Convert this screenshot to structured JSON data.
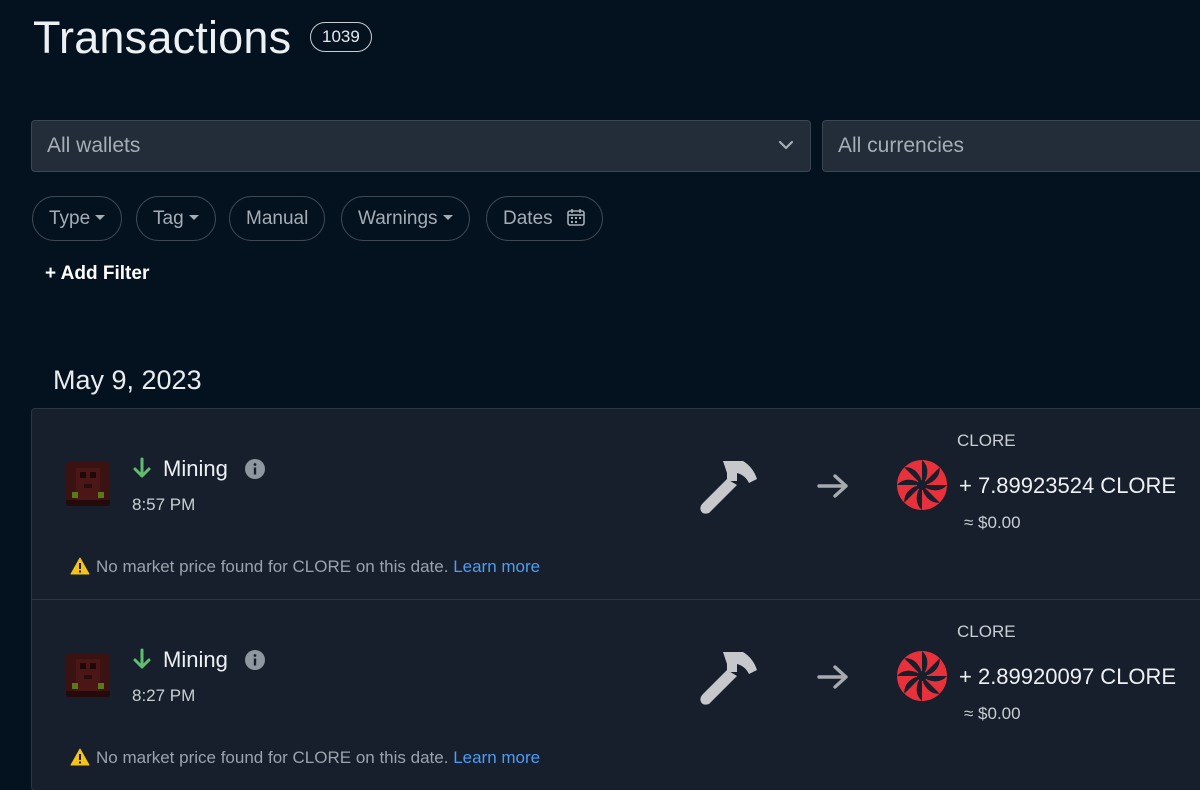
{
  "header": {
    "title": "Transactions",
    "count": "1039"
  },
  "filters": {
    "wallets_select": "All wallets",
    "currencies_select": "All currencies",
    "pills": {
      "type": "Type",
      "tag": "Tag",
      "manual": "Manual",
      "warnings": "Warnings",
      "dates": "Dates"
    },
    "add_filter": "+ Add Filter"
  },
  "date_groups": [
    {
      "date": "May 9, 2023",
      "transactions": [
        {
          "type": "Mining",
          "time": "8:57 PM",
          "currency_code": "CLORE",
          "amount": "+ 7.89923524 CLORE",
          "usd_value": "≈ $0.00",
          "warning_text": "No market price found for CLORE on this date.",
          "warning_link": "Learn more"
        },
        {
          "type": "Mining",
          "time": "8:27 PM",
          "currency_code": "CLORE",
          "amount": "+ 2.89920097 CLORE",
          "usd_value": "≈ $0.00",
          "warning_text": "No market price found for CLORE on this date.",
          "warning_link": "Learn more"
        }
      ]
    }
  ],
  "icons": {
    "direction": "arrow-down-icon",
    "info": "info-icon",
    "type_icon": "hammer-icon",
    "flow": "arrow-right-icon",
    "coin": "clore-coin-icon",
    "warning": "warning-icon",
    "calendar": "calendar-icon"
  },
  "colors": {
    "background": "#04121f",
    "card": "#161f2b",
    "incoming_arrow": "#5ebd6e",
    "link": "#4d9cf5",
    "coin_red": "#e8313a",
    "warning_yellow": "#f4c21b"
  }
}
